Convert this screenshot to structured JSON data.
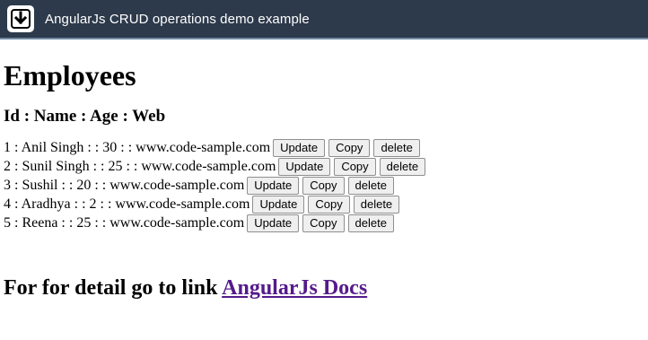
{
  "window": {
    "title": "AngularJs CRUD operations demo example",
    "icon": "download-arrow-icon"
  },
  "page": {
    "heading": "Employees",
    "columns_header": "Id : Name : Age : Web",
    "employees": [
      {
        "text": "1 : Anil Singh : : 30 : : www.code-sample.com"
      },
      {
        "text": "2 : Sunil Singh : : 25 : : www.code-sample.com"
      },
      {
        "text": "3 : Sushil : : 20 : : www.code-sample.com"
      },
      {
        "text": "4 : Aradhya : : 2 : : www.code-sample.com"
      },
      {
        "text": "5 : Reena : : 25 : : www.code-sample.com"
      }
    ],
    "buttons": {
      "update": "Update",
      "copy": "Copy",
      "delete": "delete"
    },
    "footer": {
      "prefix": "For for detail go to link",
      "link_text": "AngularJs Docs"
    }
  },
  "colors": {
    "topbar_bg": "#2d3a4b",
    "link": "#551a8b"
  }
}
